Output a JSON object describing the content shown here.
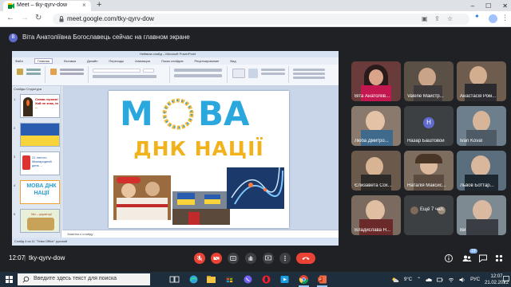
{
  "browser": {
    "tab_title": "Meet – tky-qyrv-dow",
    "new_tab": "+",
    "tab_close": "×",
    "url": "meet.google.com/tky-qyrv-dow",
    "window_controls": [
      "–",
      "☐",
      "✕"
    ]
  },
  "banner": {
    "avatar_letter": "В",
    "text": "Віта Анатоліївна Богославець сейчас на главном экране"
  },
  "presentation": {
    "window_title": "Нейвеза слайд – Microsoft PowerPoint",
    "menu_tabs": [
      "Файл",
      "Главная",
      "Вставка",
      "Дизайн",
      "Переходы",
      "Анимация",
      "Показ слайдов",
      "Рецензирование",
      "Вид"
    ],
    "active_menu": "Главная",
    "sidebar_tabs": "Слайды   Структура",
    "thumbnails": [
      {
        "num": "1",
        "text": "Слава героям! Хай не знає, ів ...",
        "bg": "#ffffff"
      },
      {
        "num": "2",
        "text": "",
        "bg": "#2a5db0"
      },
      {
        "num": "3",
        "text": "21 лютого Міжнародний день ...",
        "bg": "#ffffff"
      },
      {
        "num": "4",
        "text": "МОВА ДНК НАЦІЇ",
        "bg": "#ffffff"
      },
      {
        "num": "5",
        "text": "Ми – українці!",
        "bg": "#e9f0d8"
      }
    ],
    "slide_word_left": "М",
    "slide_word_right": "ВА",
    "slide_subtitle": "ДНК НАЦІЇ",
    "notes": "Заметки к слайду",
    "status": "Слайд 4 из 11    \"Тема Office\"    русский"
  },
  "participants": [
    {
      "name": "Віта Анатоліїв...",
      "type": "video",
      "color": "#6a3b3b"
    },
    {
      "name": "Valerie Майстр...",
      "type": "video",
      "color": "#5b5046"
    },
    {
      "name": "Анастасія Ром...",
      "type": "video",
      "color": "#6e5c4e"
    },
    {
      "name": "Люба Дмитро...",
      "type": "video",
      "color": "#8a7a6e"
    },
    {
      "name": "Назар Баштовой",
      "type": "avatar",
      "avatar_letter": "Н",
      "color": "#3c4043"
    },
    {
      "name": "Ivan Koval",
      "type": "video",
      "color": "#6d7f8c"
    },
    {
      "name": "Єлизавета Сох...",
      "type": "video",
      "color": "#6b5a4c"
    },
    {
      "name": "Наталія Максис...",
      "type": "video",
      "color": "#7c6d5e"
    },
    {
      "name": "Львов Боттар...",
      "type": "video",
      "color": "#5a6e7e"
    },
    {
      "name": "Владислава Н...",
      "type": "video",
      "color": "#7a6a60"
    },
    {
      "name": "Ещё 7 чел.",
      "type": "more",
      "color": "#3c4043"
    },
    {
      "name": "Ви",
      "type": "video",
      "color": "#7e8a92"
    }
  ],
  "meetbar": {
    "time": "12:07",
    "separator": "|",
    "code": "tky-qyrv-dow",
    "participants_count": "19"
  },
  "taskbar": {
    "search_placeholder": "Введите здесь текст для поиска",
    "weather": "9°C",
    "language": "РУС",
    "clock_time": "12:07",
    "clock_date": "21.02.2022"
  }
}
